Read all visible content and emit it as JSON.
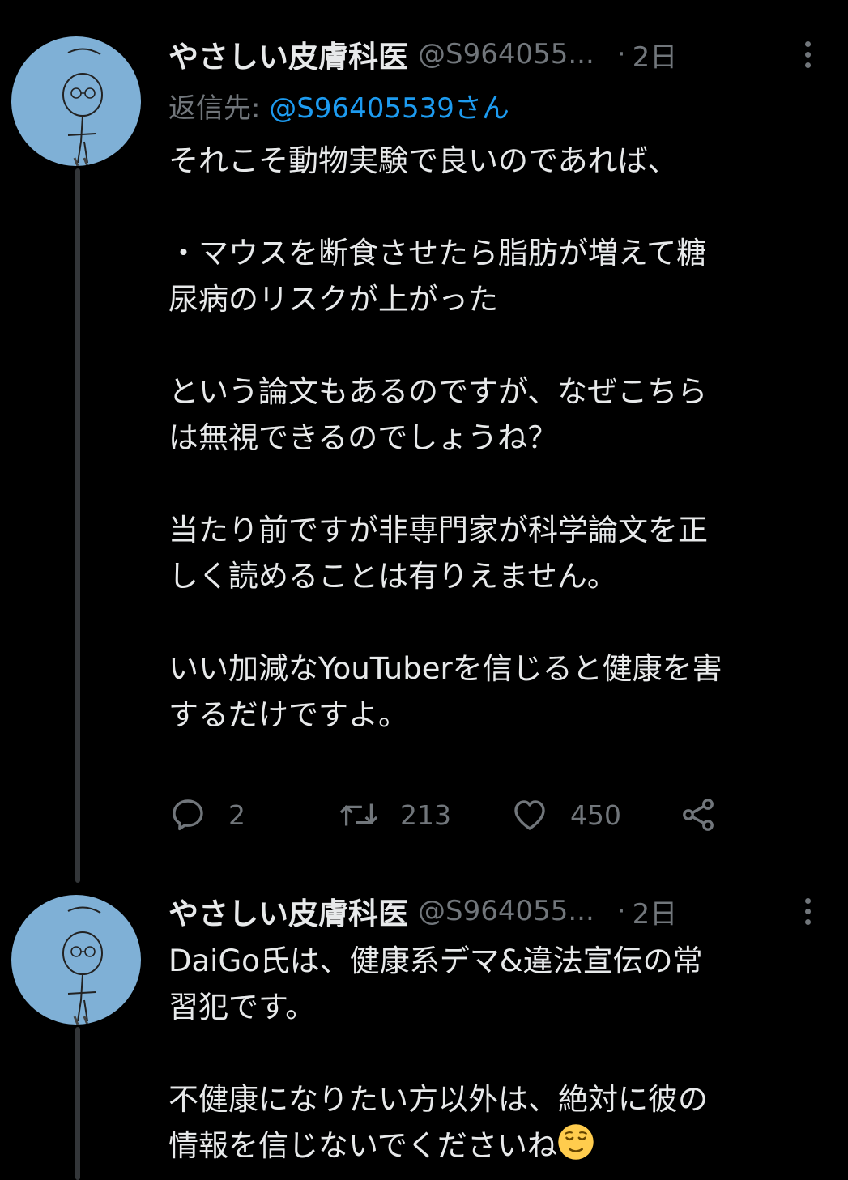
{
  "colors": {
    "background": "#000000",
    "primary_text": "#e7e9ea",
    "secondary_text": "#71767b",
    "link": "#1d9bf0",
    "avatar_bg": "#7fb0d6",
    "thread_line": "#333639"
  },
  "tweets": [
    {
      "author": {
        "name": "やさしい皮膚科医",
        "handle": "@S964055...",
        "avatar_icon": "hand-drawn-figure-avatar"
      },
      "dot": "·",
      "time": "2日",
      "reply_to": {
        "prefix": "返信先: ",
        "mention": "@S96405539さん"
      },
      "text": "それこそ動物実験で良いのであれば、\n\n・マウスを断食させたら脂肪が増えて糖\n尿病のリスクが上がった\n\nという論文もあるのですが、なぜこちら\nは無視できるのでしょうね？\n\n当たり前ですが非専門家が科学論文を正\nしく読めることは有りえません。\n\nいい加減なYouTuberを信じると健康を害\nするだけですよ。",
      "actions": {
        "reply_count": "2",
        "retweet_count": "213",
        "like_count": "450"
      }
    },
    {
      "author": {
        "name": "やさしい皮膚科医",
        "handle": "@S964055...",
        "avatar_icon": "hand-drawn-figure-avatar"
      },
      "dot": "·",
      "time": "2日",
      "text": "DaiGo氏は、健康系デマ&違法宣伝の常\n習犯です。\n\n不健康になりたい方以外は、絶対に彼の\n情報を信じないでくださいね",
      "emoji": "relieved-face-emoji"
    }
  ]
}
